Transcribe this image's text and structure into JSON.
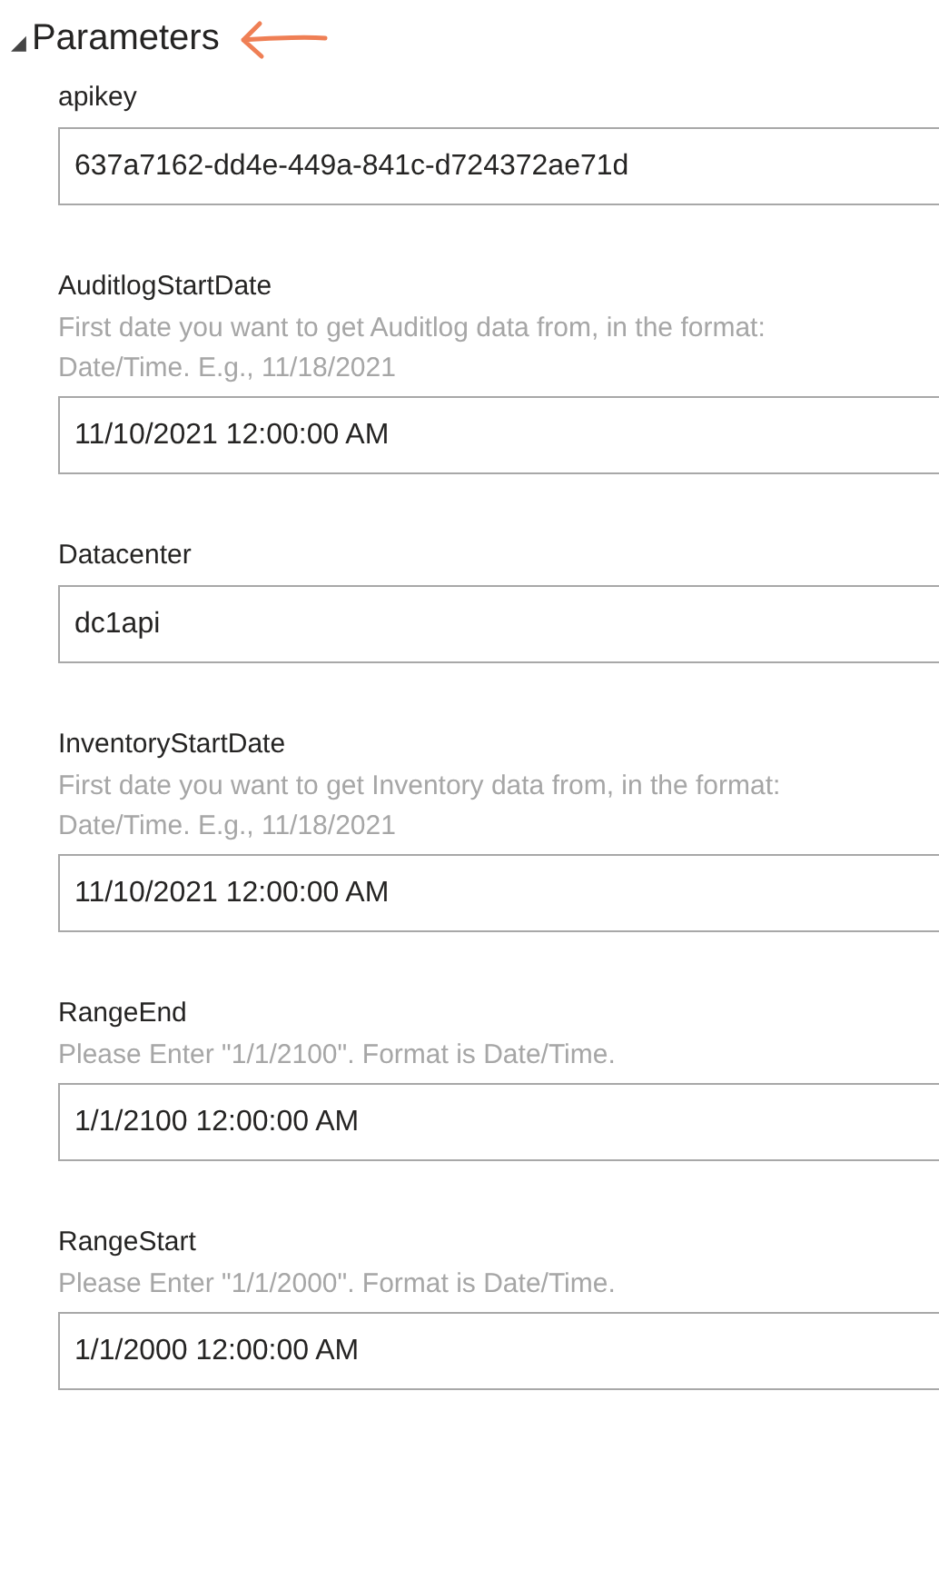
{
  "section": {
    "toggle": "◢",
    "title": "Parameters",
    "expanded": true
  },
  "parameters": [
    {
      "name": "apikey",
      "value": "637a7162-dd4e-449a-841c-d724372ae71d"
    },
    {
      "name": "AuditlogStartDate",
      "description": "First date you want to get Auditlog data from, in the format: Date/Time. E.g., 11/18/2021",
      "value": "11/10/2021 12:00:00 AM"
    },
    {
      "name": "Datacenter",
      "value": "dc1api"
    },
    {
      "name": "InventoryStartDate",
      "description": "First date you want to get Inventory data from, in the format: Date/Time. E.g., 11/18/2021",
      "value": "11/10/2021 12:00:00 AM"
    },
    {
      "name": "RangeEnd",
      "description": "Please Enter \"1/1/2100\". Format is Date/Time.",
      "value": "1/1/2100 12:00:00 AM"
    },
    {
      "name": "RangeStart",
      "description": "Please Enter \"1/1/2000\". Format is Date/Time.",
      "value": "1/1/2000 12:00:00 AM"
    }
  ]
}
